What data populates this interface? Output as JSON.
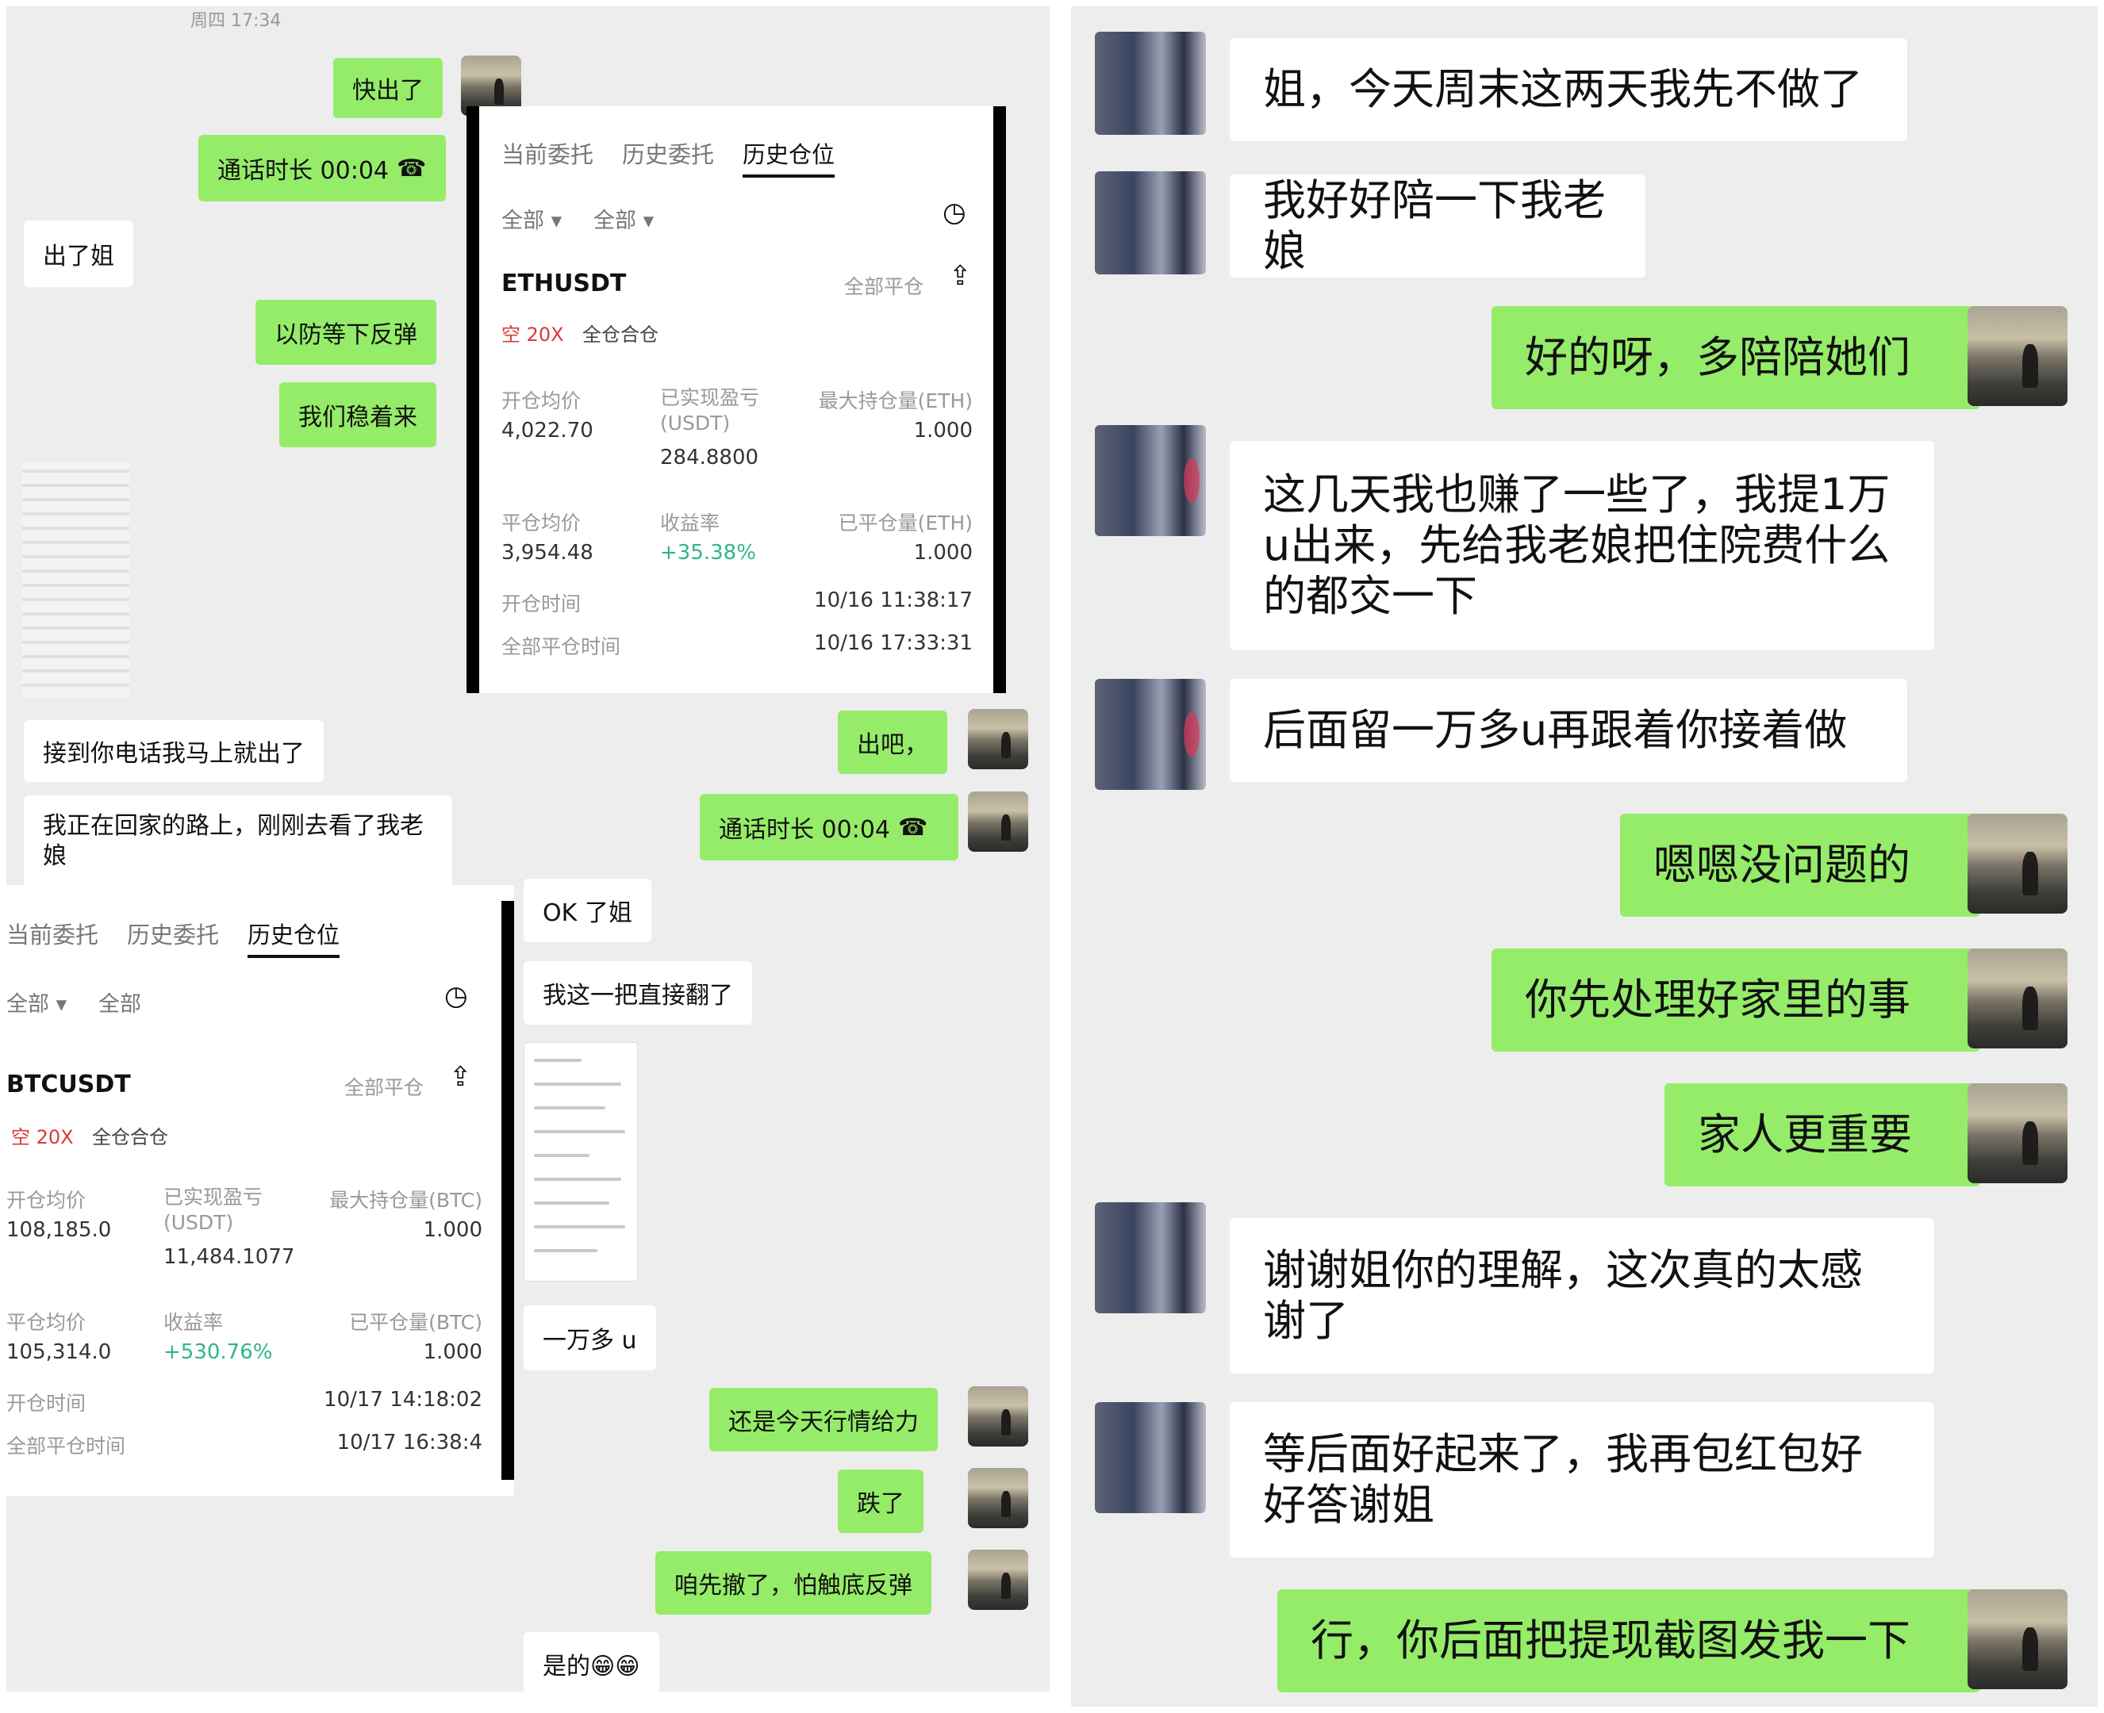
{
  "left_panel": {
    "timestamp": "周四 17:34",
    "messages": {
      "m1": "快出了",
      "m2": "通话时长 00:04",
      "m3": "出了姐",
      "m4": "以防等下反弹",
      "m5": "我们稳着来",
      "m6": "接到你电话我马上就出了",
      "m7": "我正在回家的路上，刚刚去看了我老娘",
      "m8": "出吧，",
      "m9": "通话时长 00:04",
      "m10": "OK 了姐",
      "m11": "我这一把直接翻了",
      "m12": "一万多 u",
      "m13": "还是今天行情给力",
      "m14": "跌了",
      "m15": "咱先撤了，怕触底反弹",
      "m16": "是的😁😁"
    },
    "trade_eth": {
      "tabs": [
        "当前委托",
        "历史委托",
        "历史仓位"
      ],
      "filter1": "全部 ▾",
      "filter2": "全部 ▾",
      "symbol": "ETHUSDT",
      "close_all": "全部平仓",
      "tag_side": "空 20X",
      "tag_mode": "全仓合仓",
      "open_avg_label": "开仓均价",
      "open_avg_value": "4,022.70",
      "realized_label": "已实现盈亏\n(USDT)",
      "realized_value": "284.8800",
      "max_hold_label": "最大持仓量(ETH)",
      "max_hold_value": "1.000",
      "close_avg_label": "平仓均价",
      "close_avg_value": "3,954.48",
      "roi_label": "收益率",
      "roi_value": "+35.38%",
      "closed_qty_label": "已平仓量(ETH)",
      "closed_qty_value": "1.000",
      "open_time_label": "开仓时间",
      "open_time_value": "10/16 11:38:17",
      "close_time_label": "全部平仓时间",
      "close_time_value": "10/16 17:33:31"
    },
    "trade_btc": {
      "tabs": [
        "当前委托",
        "历史委托",
        "历史仓位"
      ],
      "filter1": "全部 ▾",
      "filter2": "全部",
      "symbol": "BTCUSDT",
      "close_all": "全部平仓",
      "tag_side": "空 20X",
      "tag_mode": "全仓合仓",
      "open_avg_label": "开仓均价",
      "open_avg_value": "108,185.0",
      "realized_label": "已实现盈亏\n(USDT)",
      "realized_value": "11,484.1077",
      "max_hold_label": "最大持仓量(BTC)",
      "max_hold_value": "1.000",
      "close_avg_label": "平仓均价",
      "close_avg_value": "105,314.0",
      "roi_label": "收益率",
      "roi_value": "+530.76%",
      "closed_qty_label": "已平仓量(BTC)",
      "closed_qty_value": "1.000",
      "open_time_label": "开仓时间",
      "open_time_value": "10/17 14:18:02",
      "close_time_label": "全部平仓时间",
      "close_time_value": "10/17 16:38:4"
    },
    "icons": {
      "call": "phone-hangup-icon",
      "clock": "clock-icon",
      "share": "share-icon"
    }
  },
  "right_panel": {
    "messages": {
      "r1": "姐，今天周末这两天我先不做了",
      "r2": "我好好陪一下我老娘",
      "r3": "好的呀，多陪陪她们",
      "r4": "这几天我也赚了一些了，我提1万u出来，先给我老娘把住院费什么的都交一下",
      "r5": "后面留一万多u再跟着你接着做",
      "r6": "嗯嗯没问题的",
      "r7": "你先处理好家里的事",
      "r8": "家人更重要",
      "r9": "谢谢姐你的理解，这次真的太感谢了",
      "r10": "等后面好起来了，我再包红包好好答谢姐",
      "r11": "行，你后面把提现截图发我一下"
    }
  },
  "colors": {
    "chat_bg": "#ededed",
    "bubble_green": "#95ec69",
    "bubble_white": "#ffffff",
    "profit_green": "#2fb58a",
    "short_red": "#d93a3a"
  }
}
